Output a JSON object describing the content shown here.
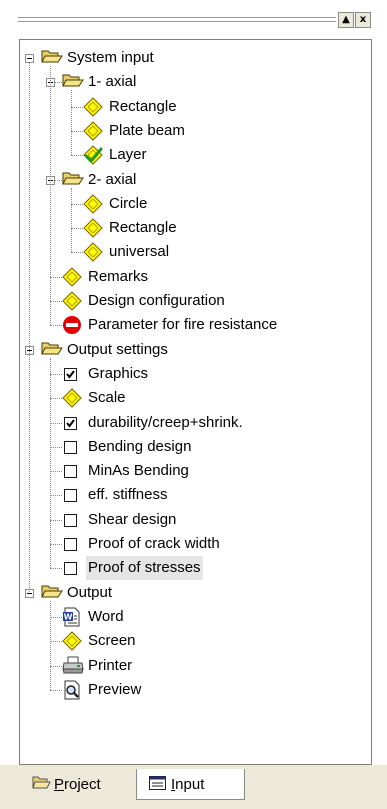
{
  "window": {
    "scroll_up_symbol": "▲",
    "close_symbol": "x"
  },
  "tree": [
    {
      "label": "System input",
      "icon": "folder-open-icon",
      "expanded": true,
      "children": [
        {
          "label": "1- axial",
          "icon": "folder-open-icon",
          "expanded": true,
          "children": [
            {
              "label": "Rectangle",
              "icon": "diamond-icon"
            },
            {
              "label": "Plate beam",
              "icon": "diamond-icon"
            },
            {
              "label": "Layer",
              "icon": "diamond-check-icon"
            }
          ]
        },
        {
          "label": "2- axial",
          "icon": "folder-open-icon",
          "expanded": true,
          "children": [
            {
              "label": "Circle",
              "icon": "diamond-icon"
            },
            {
              "label": "Rectangle",
              "icon": "diamond-icon"
            },
            {
              "label": "universal",
              "icon": "diamond-icon"
            }
          ]
        },
        {
          "label": "Remarks",
          "icon": "diamond-icon"
        },
        {
          "label": "Design  configuration",
          "icon": "diamond-icon"
        },
        {
          "label": "Parameter for fire resistance",
          "icon": "no-entry-icon"
        }
      ]
    },
    {
      "label": "Output settings",
      "icon": "folder-open-icon",
      "expanded": true,
      "children": [
        {
          "label": "Graphics",
          "icon": "checkbox",
          "checked": true
        },
        {
          "label": "Scale",
          "icon": "diamond-icon"
        },
        {
          "label": "durability/creep+shrink.",
          "icon": "checkbox",
          "checked": true
        },
        {
          "label": "Bending design",
          "icon": "checkbox",
          "checked": false
        },
        {
          "label": "MinAs Bending",
          "icon": "checkbox",
          "checked": false
        },
        {
          "label": "eff. stiffness",
          "icon": "checkbox",
          "checked": false
        },
        {
          "label": "Shear design",
          "icon": "checkbox",
          "checked": false
        },
        {
          "label": "Proof of crack width",
          "icon": "checkbox",
          "checked": false
        },
        {
          "label": "Proof of stresses",
          "icon": "checkbox",
          "checked": false,
          "selected": true
        }
      ]
    },
    {
      "label": "Output",
      "icon": "folder-open-icon",
      "expanded": true,
      "children": [
        {
          "label": "Word",
          "icon": "word-doc-icon"
        },
        {
          "label": "Screen",
          "icon": "diamond-icon"
        },
        {
          "label": "Printer",
          "icon": "printer-icon"
        },
        {
          "label": "Preview",
          "icon": "print-preview-icon"
        }
      ]
    }
  ],
  "tabs": [
    {
      "label": "Project",
      "accesskey": "P",
      "rest": "roject",
      "icon": "open-folder-icon",
      "active": false
    },
    {
      "label": "Input",
      "accesskey": "I",
      "rest": "nput",
      "icon": "form-icon",
      "active": true
    }
  ],
  "colors": {
    "folder": "#e8cf6a",
    "diamond_fill": "#ffff00",
    "diamond_border": "#7a6000",
    "no_entry": "#e00000",
    "check_green": "#1f9a1f",
    "selection": "#e5e5e5",
    "tab_bar": "#ece9d8"
  }
}
